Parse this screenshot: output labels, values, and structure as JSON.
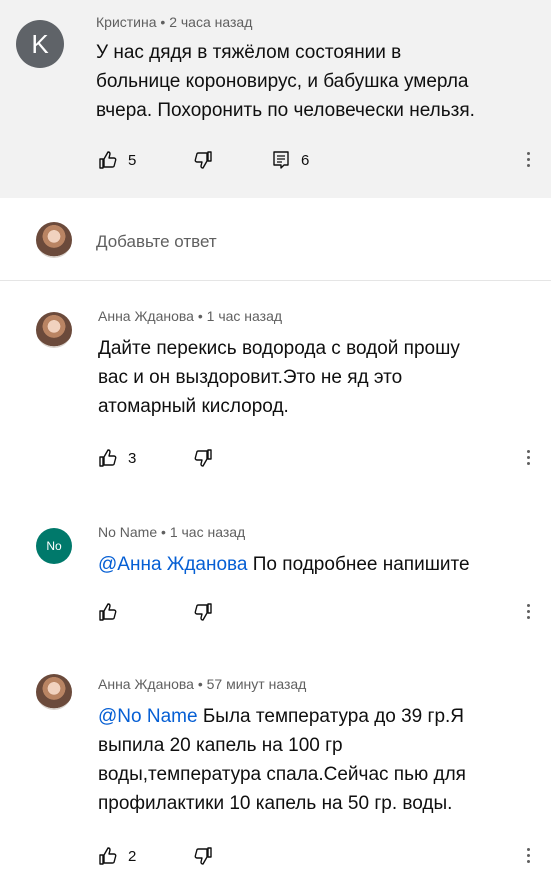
{
  "comments": [
    {
      "author": "Кристина",
      "time": "2 часа назад",
      "avatar_letter": "K",
      "text_lines": [
        "У нас дядя в тяжёлом состоянии в",
        "больнице короновирус, и бабушка умерла",
        "вчера. Похоронить по человечески нельзя."
      ],
      "likes": "5",
      "replies": "6"
    },
    {
      "author": "Анна Жданова",
      "time": "1 час назад",
      "text_lines": [
        "Дайте перекись водорода с водой прошу",
        "вас и он выздоровит.Это не яд это",
        "атомарный кислород."
      ],
      "likes": "3"
    },
    {
      "author": "No Name",
      "time": "1 час назад",
      "avatar_text": "No",
      "mention": "@Анна Жданова",
      "text_after_mention": " По подробнее напишите"
    },
    {
      "author": "Анна Жданова",
      "time": "57 минут назад",
      "mention": "@No Name",
      "text_after_mention": " Была температура до 39 гр.Я",
      "text_lines": [
        "выпила 20 капель на 100 гр",
        "воды,температура спала.Сейчас пью для",
        "профилактики 10 капель на 50 гр. воды."
      ],
      "likes": "2"
    }
  ],
  "separator": "•",
  "add_reply_placeholder": "Добавьте ответ",
  "icons": {
    "like": "thumbs-up-icon",
    "dislike": "thumbs-down-icon",
    "reply": "reply-icon",
    "menu": "more-vert-icon"
  }
}
